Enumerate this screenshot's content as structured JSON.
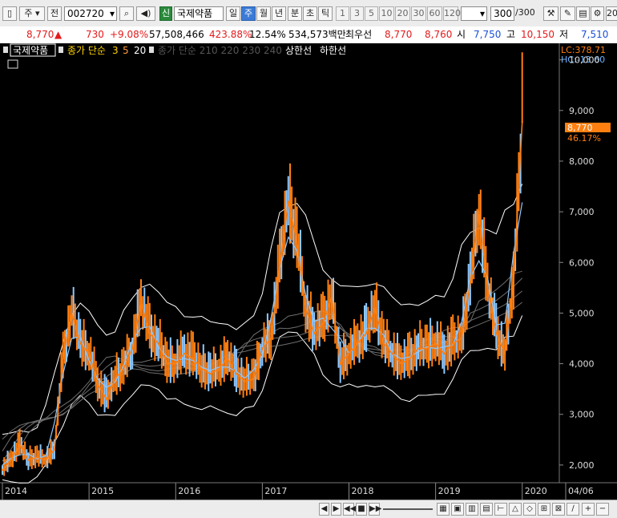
{
  "toolbar": {
    "market_select": "주",
    "prev_button": "전",
    "code_value": "002720",
    "new_badge": "신",
    "stock_name": "국제약품",
    "periods": [
      "일",
      "주",
      "월",
      "년",
      "분",
      "초",
      "틱"
    ],
    "selected_period": "주",
    "intervals": [
      "1",
      "3",
      "5",
      "10",
      "20",
      "30",
      "60",
      "120"
    ],
    "count_value": "300",
    "count_total": "/300",
    "right_value": "20"
  },
  "quote": {
    "price": "8,770",
    "up_arrow": "▲",
    "change": "730",
    "change_pct": "+9.08%",
    "volume": "57,508,466",
    "volume_ratio": "423.88%",
    "turnover": "12.54%",
    "amount": "534,573백만",
    "best_ask_label": "최우선",
    "best_ask": "8,770",
    "best_bid": "8,760",
    "open_label": "시",
    "open": "7,750",
    "high_label": "고",
    "high": "10,150",
    "low_label": "저",
    "low": "7,510"
  },
  "legend": {
    "stock_name": "국제약품",
    "ma_prefix": "종가 단순",
    "ma_periods": [
      "3",
      "5",
      "20"
    ],
    "ma_gray": "종가 단순 210  220  230  240",
    "upper_band": "상한선",
    "lower_band": "하한선"
  },
  "readout": {
    "lc": "LC:378.71",
    "hc": "HC:-13.60",
    "current_price": "8,770",
    "current_pct": "46.17%"
  },
  "colors": {
    "background": "#000000",
    "price_line": "#ff7f11",
    "ma_short": "#8ec8ff",
    "bands": "#ffffff",
    "ma_long": "#6e6e6e",
    "axis_text": "#ffffff",
    "up": "#e41b1b",
    "down": "#1b4fd8"
  },
  "chart_data": {
    "type": "line",
    "title": "",
    "x_labels": [
      "2014",
      "2015",
      "2016",
      "2017",
      "2018",
      "2019",
      "2020",
      "04/06"
    ],
    "y_ticks": [
      2000,
      3000,
      4000,
      5000,
      6000,
      7000,
      8000,
      9000,
      10000
    ],
    "y_tick_labels": [
      "2,000",
      "3,000",
      "4,000",
      "5,000",
      "6,000",
      "7,000",
      "8,000",
      "9,000",
      "10,000"
    ],
    "ylim": [
      1650,
      10200
    ],
    "series": [
      {
        "name": "종가",
        "x": [
          2014.0,
          2014.1,
          2014.2,
          2014.3,
          2014.4,
          2014.5,
          2014.6,
          2014.7,
          2014.8,
          2014.9,
          2015.0,
          2015.1,
          2015.2,
          2015.3,
          2015.4,
          2015.5,
          2015.6,
          2015.7,
          2015.8,
          2015.9,
          2016.0,
          2016.1,
          2016.2,
          2016.3,
          2016.4,
          2016.5,
          2016.6,
          2016.7,
          2016.8,
          2016.9,
          2017.0,
          2017.1,
          2017.2,
          2017.3,
          2017.4,
          2017.5,
          2017.6,
          2017.7,
          2017.8,
          2017.9,
          2018.0,
          2018.1,
          2018.2,
          2018.3,
          2018.4,
          2018.5,
          2018.6,
          2018.7,
          2018.8,
          2018.9,
          2019.0,
          2019.1,
          2019.2,
          2019.3,
          2019.4,
          2019.5,
          2019.6,
          2019.7,
          2019.8,
          2019.9,
          2020.0,
          2020.05,
          2020.1,
          2020.15,
          2020.2,
          2020.26
        ],
        "values": [
          1900,
          2100,
          2400,
          2100,
          2150,
          2100,
          2300,
          4100,
          5000,
          4400,
          4200,
          3600,
          3300,
          3700,
          3900,
          4300,
          5200,
          4600,
          4400,
          4000,
          4000,
          4200,
          4100,
          3900,
          3800,
          3900,
          4100,
          3800,
          3650,
          3700,
          4300,
          4500,
          5900,
          7200,
          6400,
          5100,
          4600,
          4800,
          5300,
          4000,
          4200,
          4400,
          4600,
          5100,
          4400,
          4200,
          4000,
          4100,
          4300,
          4300,
          4400,
          4200,
          4400,
          4500,
          5600,
          7000,
          5500,
          4600,
          4200,
          5600,
          8770,
          0,
          0,
          0,
          0,
          0
        ]
      }
    ]
  },
  "bottombar": {
    "labels": [
      "◀",
      "▶",
      "◀◀",
      "■",
      "▶▶",
      "+",
      "−"
    ]
  }
}
